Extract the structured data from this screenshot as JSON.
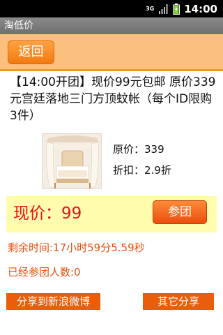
{
  "status_bar": {
    "network_label": "3G",
    "time": "14:00",
    "icons": [
      "3g-signal-icon",
      "signal-bars-icon",
      "battery-icon"
    ]
  },
  "app": {
    "title": "淘低价"
  },
  "header": {
    "back_label": "返回"
  },
  "product": {
    "title": "【14:00开团】现价99元包邮 原价339元宫廷落地三门方顶蚊帐（每个ID限购3件）",
    "image_icon": "bed-canopy-image",
    "original_price": "原价：339",
    "discount": "折扣：2.9折"
  },
  "deal": {
    "current_price": "现价：99",
    "join_label": "参团",
    "remaining_time": "剩余时间:17小时59分5.59秒",
    "joined_count": "已经参团人数:0"
  },
  "share": {
    "weibo_label": "分享到新浪微博",
    "other_label": "其它分享"
  },
  "colors": {
    "header_bg": "#fcc07e",
    "accent_orange": "#ea5d0a",
    "price_red": "#e8101a",
    "price_panel_bg": "#fffcae"
  }
}
